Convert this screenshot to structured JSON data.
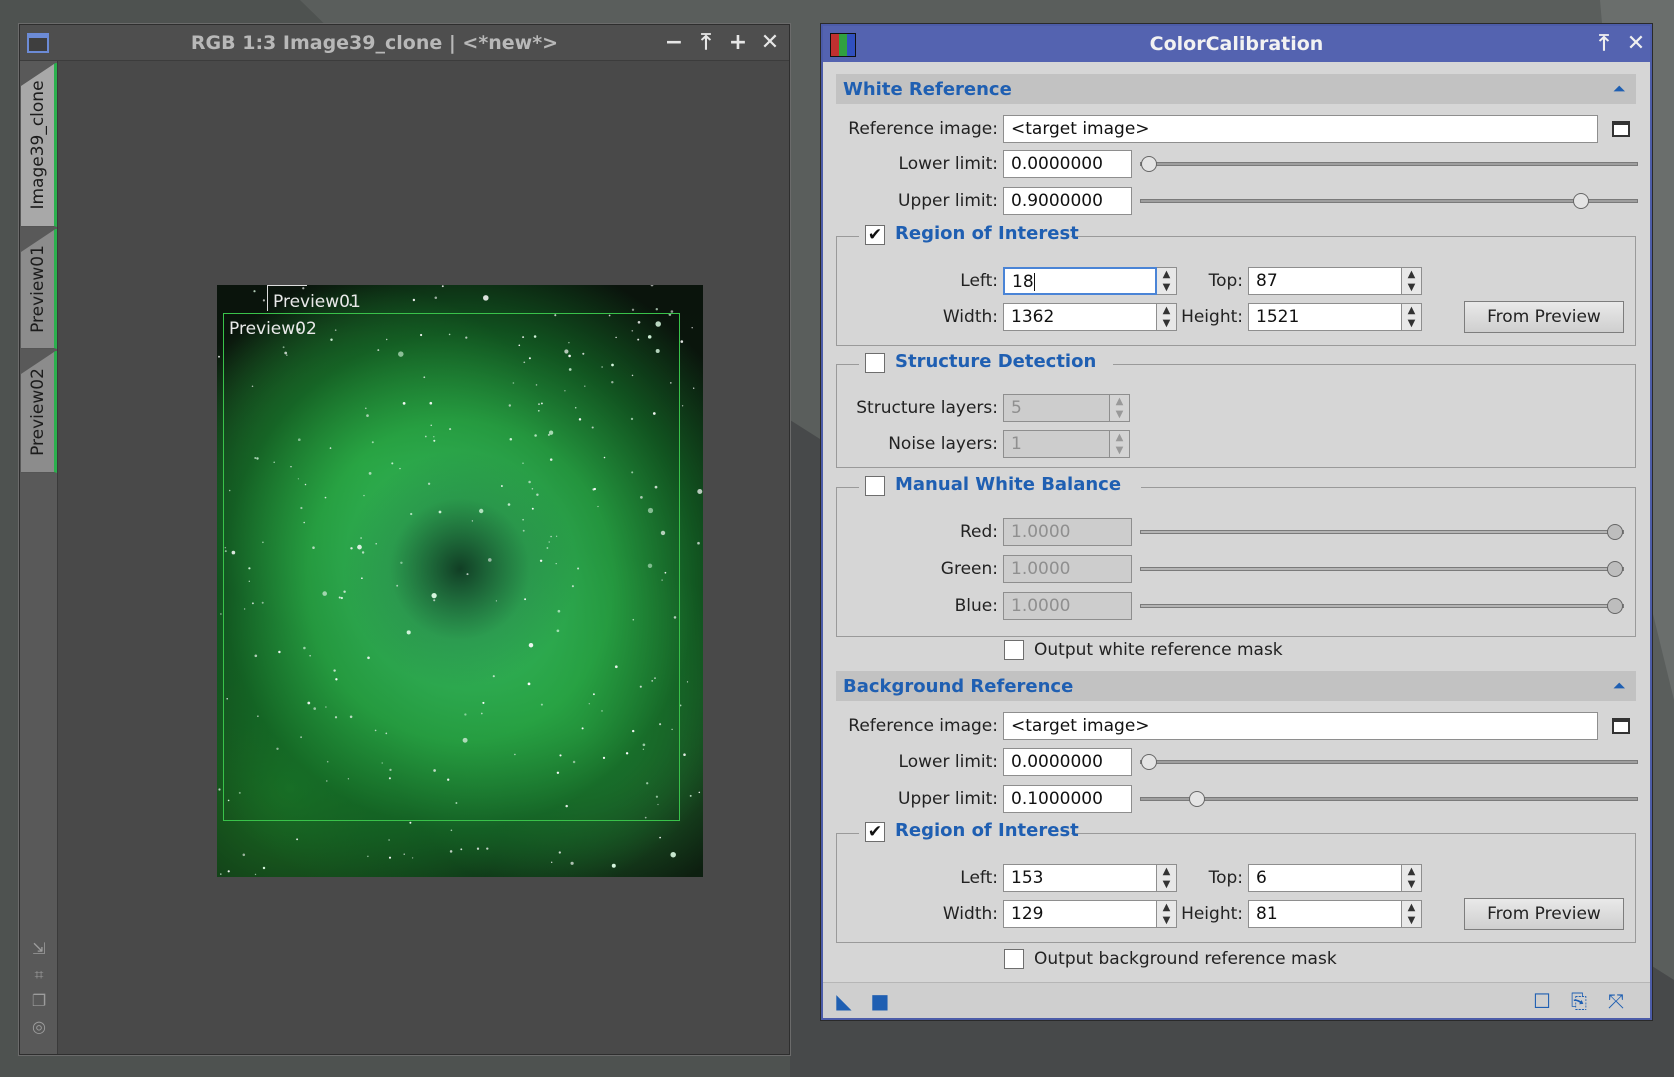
{
  "image_window": {
    "title": "RGB 1:3 Image39_clone | <*new*>",
    "controls": [
      "minimize-icon",
      "shade-icon",
      "maximize-icon",
      "close-icon"
    ],
    "tabs": [
      {
        "label": "Image39_clone"
      },
      {
        "label": "Preview01"
      },
      {
        "label": "Preview02"
      }
    ],
    "previews": {
      "p1": "Preview01",
      "p2": "Preview02"
    },
    "tool_icons": [
      "resize-icon",
      "fit-icon",
      "clone-icon",
      "target-icon"
    ]
  },
  "dialog": {
    "title": "ColorCalibration",
    "white_reference": {
      "header": "White Reference",
      "reference_image_label": "Reference image:",
      "reference_image_value": "<target image>",
      "lower_limit_label": "Lower limit:",
      "lower_limit_value": "0.0000000",
      "lower_limit_fraction": 0.0,
      "upper_limit_label": "Upper limit:",
      "upper_limit_value": "0.9000000",
      "upper_limit_fraction": 0.9,
      "roi": {
        "title": "Region of Interest",
        "checked": true,
        "left_label": "Left:",
        "left_value": "18",
        "top_label": "Top:",
        "top_value": "87",
        "width_label": "Width:",
        "width_value": "1362",
        "height_label": "Height:",
        "height_value": "1521",
        "from_preview": "From Preview"
      },
      "structure": {
        "title": "Structure Detection",
        "checked": false,
        "layers_label": "Structure layers:",
        "layers_value": "5",
        "noise_label": "Noise layers:",
        "noise_value": "1"
      },
      "manual_wb": {
        "title": "Manual White Balance",
        "checked": false,
        "red_label": "Red:",
        "red_value": "1.0000",
        "green_label": "Green:",
        "green_value": "1.0000",
        "blue_label": "Blue:",
        "blue_value": "1.0000",
        "fraction": 1.0
      },
      "output_mask_label": "Output white reference mask"
    },
    "background_reference": {
      "header": "Background Reference",
      "reference_image_label": "Reference image:",
      "reference_image_value": "<target image>",
      "lower_limit_label": "Lower limit:",
      "lower_limit_value": "0.0000000",
      "lower_limit_fraction": 0.0,
      "upper_limit_label": "Upper limit:",
      "upper_limit_value": "0.1000000",
      "upper_limit_fraction": 0.1,
      "roi": {
        "title": "Region of Interest",
        "checked": true,
        "left_label": "Left:",
        "left_value": "153",
        "top_label": "Top:",
        "top_value": "6",
        "width_label": "Width:",
        "width_value": "129",
        "height_label": "Height:",
        "height_value": "81",
        "from_preview": "From Preview"
      },
      "output_mask_label": "Output background reference mask"
    },
    "footer_icons": [
      "new-instance-icon",
      "apply-icon",
      "reset-icon",
      "save-icon",
      "collapse-icon"
    ]
  }
}
